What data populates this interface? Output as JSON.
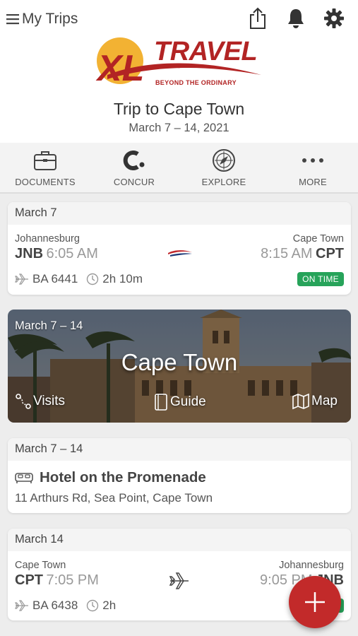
{
  "header": {
    "menu_label": "My Trips",
    "icons": [
      "menu-icon",
      "share-icon",
      "bell-icon",
      "gear-icon"
    ]
  },
  "brand": {
    "name": "TRAVEL",
    "prefix": "XL",
    "tagline": "BEYOND THE ORDINARY",
    "colors": {
      "red": "#b22424",
      "yellow": "#f2b233"
    }
  },
  "trip": {
    "title": "Trip to Cape Town",
    "dates": "March 7 – 14, 2021"
  },
  "toolbar": [
    {
      "label": "DOCUMENTS",
      "icon": "briefcase-icon"
    },
    {
      "label": "CONCUR",
      "icon": "concur-icon"
    },
    {
      "label": "EXPLORE",
      "icon": "compass-icon"
    },
    {
      "label": "MORE",
      "icon": "more-dots-icon"
    }
  ],
  "flight1": {
    "date": "March 7",
    "from_city": "Johannesburg",
    "from_code": "JNB",
    "depart_time": "6:05 AM",
    "to_city": "Cape Town",
    "to_code": "CPT",
    "arrive_time": "8:15 AM",
    "flight_no": "BA 6441",
    "duration": "2h 10m",
    "status": "ON TIME",
    "status_color": "#27a35a"
  },
  "destination": {
    "dates": "March 7 – 14",
    "city": "Cape Town",
    "links": [
      "Visits",
      "Guide",
      "Map"
    ]
  },
  "hotel": {
    "dates": "March 7 – 14",
    "name": "Hotel on the Promenade",
    "address": "11 Arthurs Rd, Sea Point, Cape Town"
  },
  "flight2": {
    "date": "March 14",
    "from_city": "Cape Town",
    "from_code": "CPT",
    "depart_time": "7:05 PM",
    "to_city": "Johannesburg",
    "to_code": "JNB",
    "arrive_time": "9:05 PM",
    "flight_no": "BA 6438",
    "duration": "2h"
  },
  "fab": {
    "icon": "plus-icon",
    "color": "#c22a2a"
  }
}
